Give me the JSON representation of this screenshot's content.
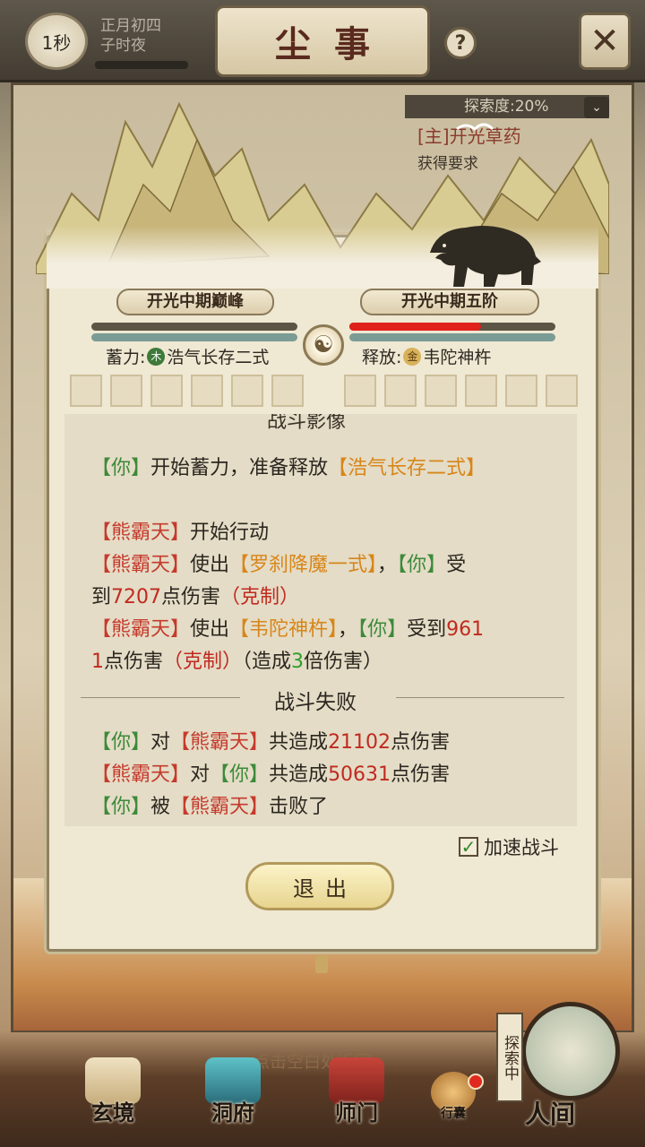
{
  "topbar": {
    "timer": "1秒",
    "date_line1": "正月初四",
    "date_line2": "子时夜",
    "title": "尘事",
    "help": "?",
    "close": "✕"
  },
  "side_quests": {
    "explore_label": "探索度:20%",
    "quest1": "[主]开光草药",
    "quest2": "获得要求"
  },
  "battle": {
    "player_realm": "开光中期巅峰",
    "enemy_realm": "开光中期五阶",
    "enemy_hp_fraction": 0.64,
    "charge_label": "蓄力:",
    "charge_element": "木",
    "charge_skill": "浩气长存二式",
    "release_label": "释放:",
    "release_element": "金",
    "release_skill": "韦陀神杵"
  },
  "log": {
    "cut_line": "战斗影像",
    "l1_you": "【你】",
    "l1_text": "开始蓄力，准备释放",
    "l1_skill": "【浩气长存二式】",
    "l2_enemy": "【熊霸天】",
    "l2_text": "开始行动",
    "l3_enemy": "【熊霸天】",
    "l3_text": "使出",
    "l3_skill": "【罗刹降魔一式】",
    "l3_comma": "，",
    "l3_you": "【你】",
    "l3_text2": "受",
    "l4_text": "到",
    "l4_num": "7207",
    "l4_text2": "点伤害",
    "l4_counter": "（克制）",
    "l5_enemy": "【熊霸天】",
    "l5_text": "使出",
    "l5_skill": "【韦陀神杵】",
    "l5_comma": "，",
    "l5_you": "【你】",
    "l5_text2": "受到",
    "l5_num": "961",
    "l6_num": "1",
    "l6_text": "点伤害",
    "l6_counter": "（克制）",
    "l6_text2": "（造成",
    "l6_mult": "3",
    "l6_text3": "倍伤害）",
    "result": "战斗失败",
    "s1_you": "【你】",
    "s1_text": "对",
    "s1_enemy": "【熊霸天】",
    "s1_text2": "共造成",
    "s1_num": "21102",
    "s1_text3": "点伤害",
    "s2_enemy": "【熊霸天】",
    "s2_text": "对",
    "s2_you": "【你】",
    "s2_text2": "共造成",
    "s2_num": "50631",
    "s2_text3": "点伤害",
    "s3_you": "【你】",
    "s3_text": "被",
    "s3_enemy": "【熊霸天】",
    "s3_text2": "击败了"
  },
  "controls": {
    "speed_label": "加速战斗",
    "speed_checked": true,
    "exit_label": "退出"
  },
  "bottom": {
    "tap_hint": "点击空白处返回",
    "nav_xuanjing": "玄境",
    "nav_dongfu": "洞府",
    "nav_shimen": "师门",
    "nav_xingnang": "行囊",
    "explore_flag": "探索中",
    "nav_renjian": "人间"
  },
  "colors": {
    "player_tag": "#3c8a3a",
    "enemy_tag": "#c63a2c",
    "skill": "#d8861a",
    "damage": "#c02a20",
    "hp_bar": "#e0201a"
  }
}
